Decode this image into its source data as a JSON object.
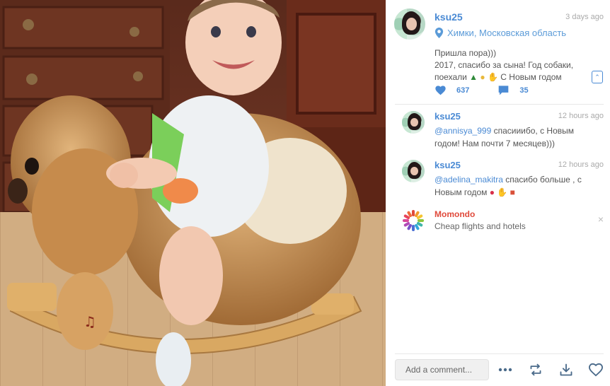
{
  "post": {
    "username": "ksu25",
    "time": "3 days ago",
    "location": "Химки, Московская область",
    "caption_line1": "Пришла пора)))",
    "caption_line2": "2017, спасибо за сына! Год собаки,",
    "caption_line3": "поехали",
    "caption_line3_end": "С Новым годом",
    "likes": "637",
    "comments_count": "35"
  },
  "comments": [
    {
      "username": "ksu25",
      "time": "12 hours ago",
      "mention": "@annisya_999",
      "text": " спасииибо, с Новым годом! Нам почти 7 месяцев)))"
    },
    {
      "username": "ksu25",
      "time": "12 hours ago",
      "mention": "@adelina_makitra",
      "text": " спасибо больше , с Новым годом"
    }
  ],
  "ad": {
    "title": "Momondo",
    "subtitle": "Cheap flights and hotels",
    "close": "×"
  },
  "footer": {
    "add_comment": "Add a comment..."
  },
  "colors": {
    "accent": "#4a8ad4",
    "ad_title": "#e04a3b"
  },
  "icons": [
    "location-pin-icon",
    "heart-icon",
    "comment-icon",
    "expand-icon",
    "more-icon",
    "repost-icon",
    "download-icon",
    "like-outline-icon",
    "close-icon"
  ]
}
